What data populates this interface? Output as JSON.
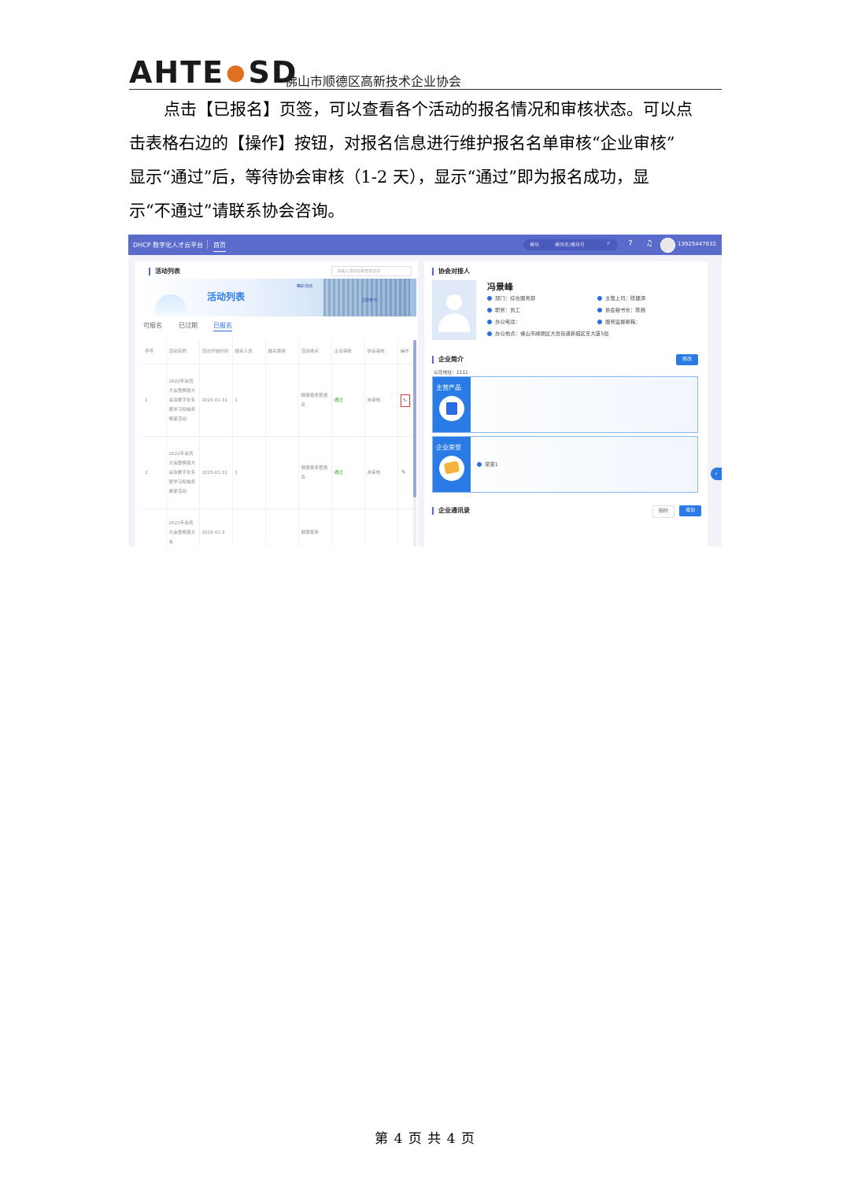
{
  "header": {
    "logo_left": "AHTE",
    "logo_right": "SD",
    "org_name": "佛山市顺德区高新技术企业协会"
  },
  "body": {
    "paragraph_lines": [
      "点击【已报名】页签，可以查看各个活动的报名情况和审核状态。可以点",
      "击表格右边的【操作】按钮，对报名信息进行维护报名名单审核“企业审核”",
      "显示“通过”后，等待协会审核（1-2 天），显示“通过”即为报名成功，显",
      "示“不通过”请联系协会咨询。"
    ]
  },
  "screenshot": {
    "topbar": {
      "brand": "DHCP 数字化人才云平台",
      "home_tab": "首页",
      "module_label": "模块",
      "search_placeholder": "模块名/模块号",
      "phone": "13925447832"
    },
    "activity_panel": {
      "title": "活动列表",
      "search_placeholder": "请输入活动名称查找活动",
      "banner_title": "活动列表",
      "banner_tag1": "精彩活动",
      "banner_tag2": "立即参与",
      "tabs": [
        "可报名",
        "已过期",
        "已报名"
      ],
      "table": {
        "headers": [
          "序号",
          "活动名称",
          "活动开始时间",
          "报名人员",
          "报名费用",
          "活动地点",
          "企业审核",
          "协会审核",
          "操作"
        ],
        "rows": [
          [
            "1",
            "2022年会员大会暨换届大会及数字化专题学习和抽奖晚宴活动",
            "2023-01-31",
            "1",
            "",
            "顺德喜来登酒店",
            "通过",
            "未审核",
            "✎"
          ],
          [
            "2",
            "2022年会员大会暨换届大会及数字化专题学习和抽奖晚宴活动",
            "2023-01-31",
            "1",
            "",
            "顺德喜来登酒店",
            "通过",
            "未审核",
            "✎"
          ],
          [
            "",
            "2022年会员大会暨换届大会",
            "2023-01-3",
            "",
            "",
            "顺德喜来",
            "",
            "",
            ""
          ]
        ]
      }
    },
    "contact_panel": {
      "title": "协会对接人",
      "name": "冯景峰",
      "dept": "部门：综合服务部",
      "post": "职务：员工",
      "office_phone": "办公电话：",
      "office_addr": "办公地点：佛山市顺德区大良街道新城区东大厦5层",
      "supervisor": "主管上司：陈健添",
      "secretary": "协会秘书长：陈扬",
      "email": "服务监督邮箱："
    },
    "company_panel": {
      "title": "企业简介",
      "edit_button": "修改",
      "address": "公司地址：1111",
      "products_label": "主营产品",
      "honors_label": "企业荣誉",
      "honor_item": "荣誉1"
    },
    "contacts_panel": {
      "title": "企业通讯录",
      "delete_button": "删除",
      "add_button": "增加"
    }
  },
  "footer": {
    "page_text": "第 4 页 共 4 页"
  }
}
